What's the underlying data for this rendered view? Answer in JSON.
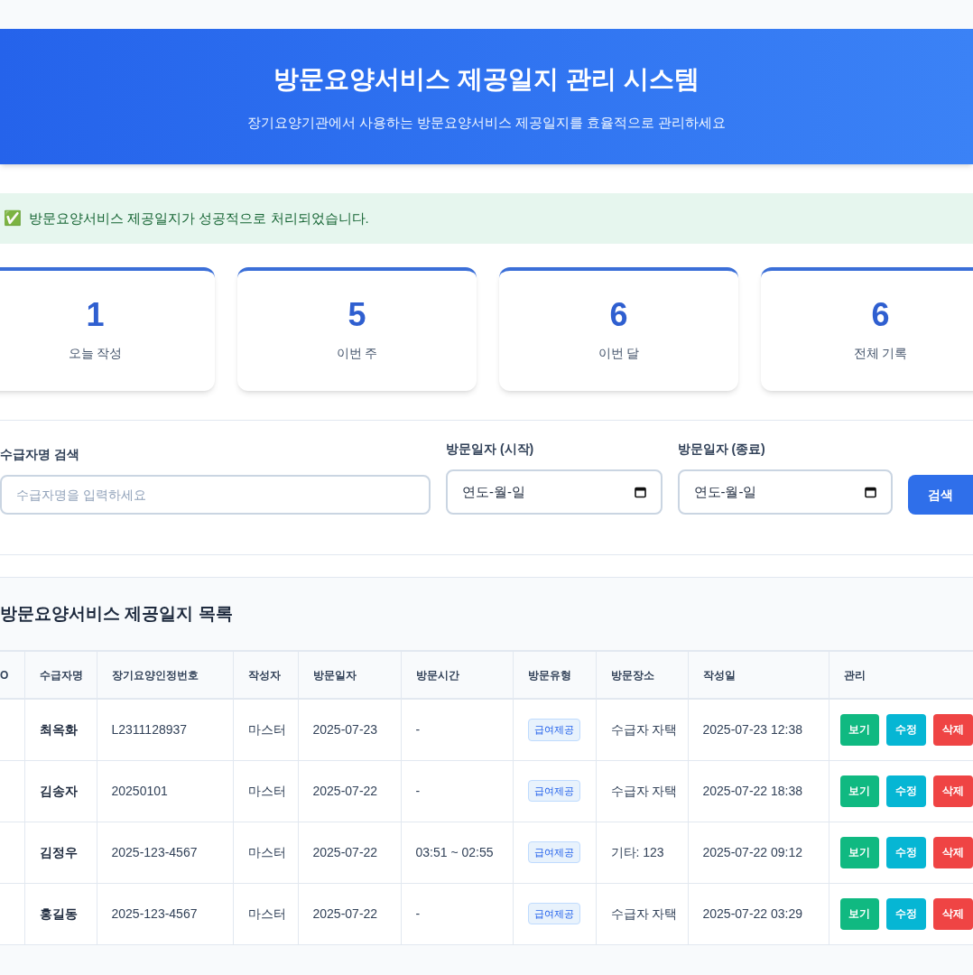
{
  "header": {
    "title": "방문요양서비스 제공일지 관리 시스템",
    "subtitle": "장기요양기관에서 사용하는 방문요양서비스 제공일지를 효율적으로 관리하세요"
  },
  "alert": {
    "icon": "✅",
    "message": "방문요양서비스 제공일지가 성공적으로 처리되었습니다."
  },
  "stats": [
    {
      "value": "1",
      "label": "오늘 작성"
    },
    {
      "value": "5",
      "label": "이번 주"
    },
    {
      "value": "6",
      "label": "이번 달"
    },
    {
      "value": "6",
      "label": "전체 기록"
    }
  ],
  "search": {
    "name_label": "수급자명 검색",
    "name_placeholder": "수급자명을 입력하세요",
    "start_label": "방문일자 (시작)",
    "start_value": "연도-월-일",
    "end_label": "방문일자 (종료)",
    "end_value": "연도-월-일",
    "button": "검색"
  },
  "table": {
    "title": "방문요양서비스 제공일지 목록",
    "columns": [
      "O",
      "수급자명",
      "장기요양인정번호",
      "작성자",
      "방문일자",
      "방문시간",
      "방문유형",
      "방문장소",
      "작성일",
      "관리"
    ],
    "rows": [
      {
        "name": "최옥화",
        "cert": "L2311128937",
        "author": "마스터",
        "date": "2025-07-23",
        "time": "-",
        "type": "급여제공",
        "place": "수급자 자택",
        "created": "2025-07-23 12:38",
        "actions": [
          "보기",
          "수정",
          "삭제"
        ]
      },
      {
        "name": "김송자",
        "cert": "20250101",
        "author": "마스터",
        "date": "2025-07-22",
        "time": "-",
        "type": "급여제공",
        "place": "수급자 자택",
        "created": "2025-07-22 18:38",
        "actions": [
          "보기",
          "수정",
          "삭제"
        ]
      },
      {
        "name": "김정우",
        "cert": "2025-123-4567",
        "author": "마스터",
        "date": "2025-07-22",
        "time": "03:51 ~ 02:55",
        "type": "급여제공",
        "place": "기타: 123",
        "created": "2025-07-22 09:12",
        "actions": [
          "보기",
          "수정",
          "삭제"
        ]
      },
      {
        "name": "홍길동",
        "cert": "2025-123-4567",
        "author": "마스터",
        "date": "2025-07-22",
        "time": "-",
        "type": "급여제공",
        "place": "수급자 자택",
        "created": "2025-07-22 03:29",
        "actions": [
          "보기",
          "수정",
          "삭제"
        ]
      }
    ]
  }
}
